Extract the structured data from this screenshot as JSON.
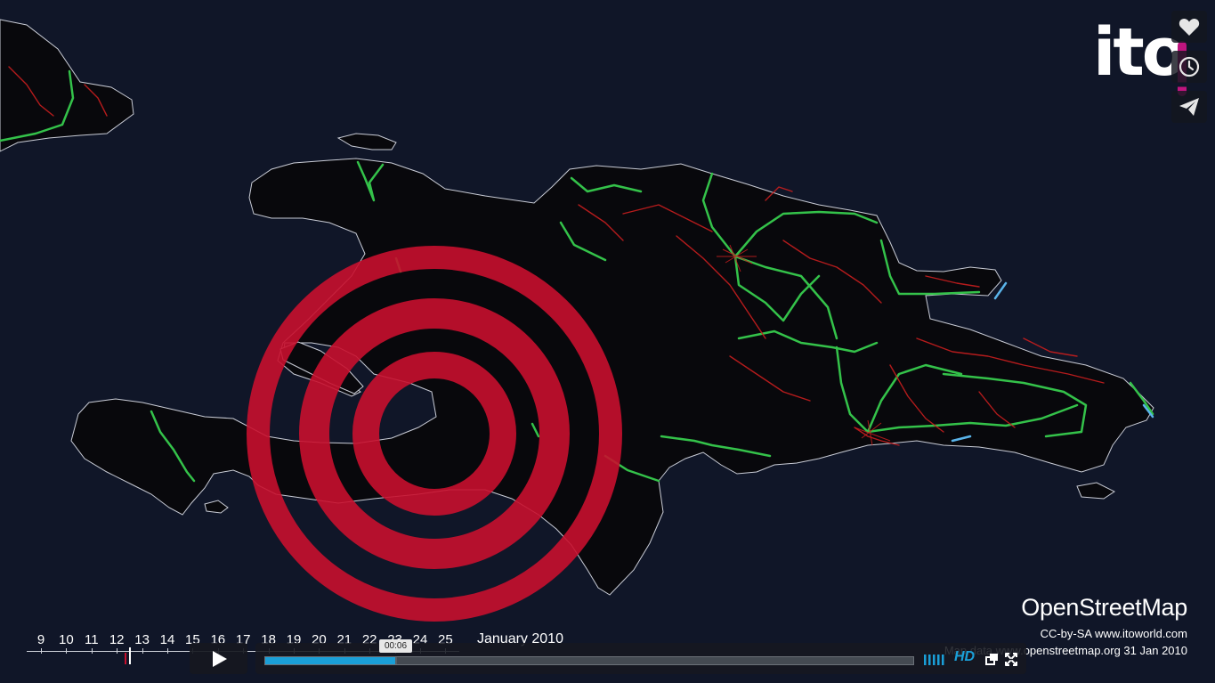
{
  "logo": {
    "text": "ito"
  },
  "side_actions": [
    {
      "name": "like",
      "icon": "heart-icon"
    },
    {
      "name": "watch-later",
      "icon": "clock-icon"
    },
    {
      "name": "share",
      "icon": "paper-plane-icon"
    }
  ],
  "attribution": {
    "title": "OpenStreetMap",
    "license": "CC-by-SA www.itoworld.com",
    "source": "Map data www.openstreetmap.org 31 Jan 2010"
  },
  "timeline": {
    "days": [
      "9",
      "10",
      "11",
      "12",
      "13",
      "14",
      "15",
      "16",
      "17",
      "18",
      "19",
      "20",
      "21",
      "22",
      "23",
      "24",
      "25"
    ],
    "month": "January 2010",
    "event_day": 12.3,
    "current_day": 12.5
  },
  "player": {
    "state": "paused",
    "time_tooltip": "00:06",
    "progress_played": 0.201,
    "progress_buffered": 0.203,
    "hd_label": "HD"
  },
  "colors": {
    "background": "#101628",
    "land": "#08080c",
    "coast": "#c9ccd6",
    "road_major": "#34c24a",
    "road_minor": "#c81e1e",
    "road_highlight": "#5ab4ea",
    "epicenter": "#c8102e",
    "accent": "#1a9fd8"
  }
}
